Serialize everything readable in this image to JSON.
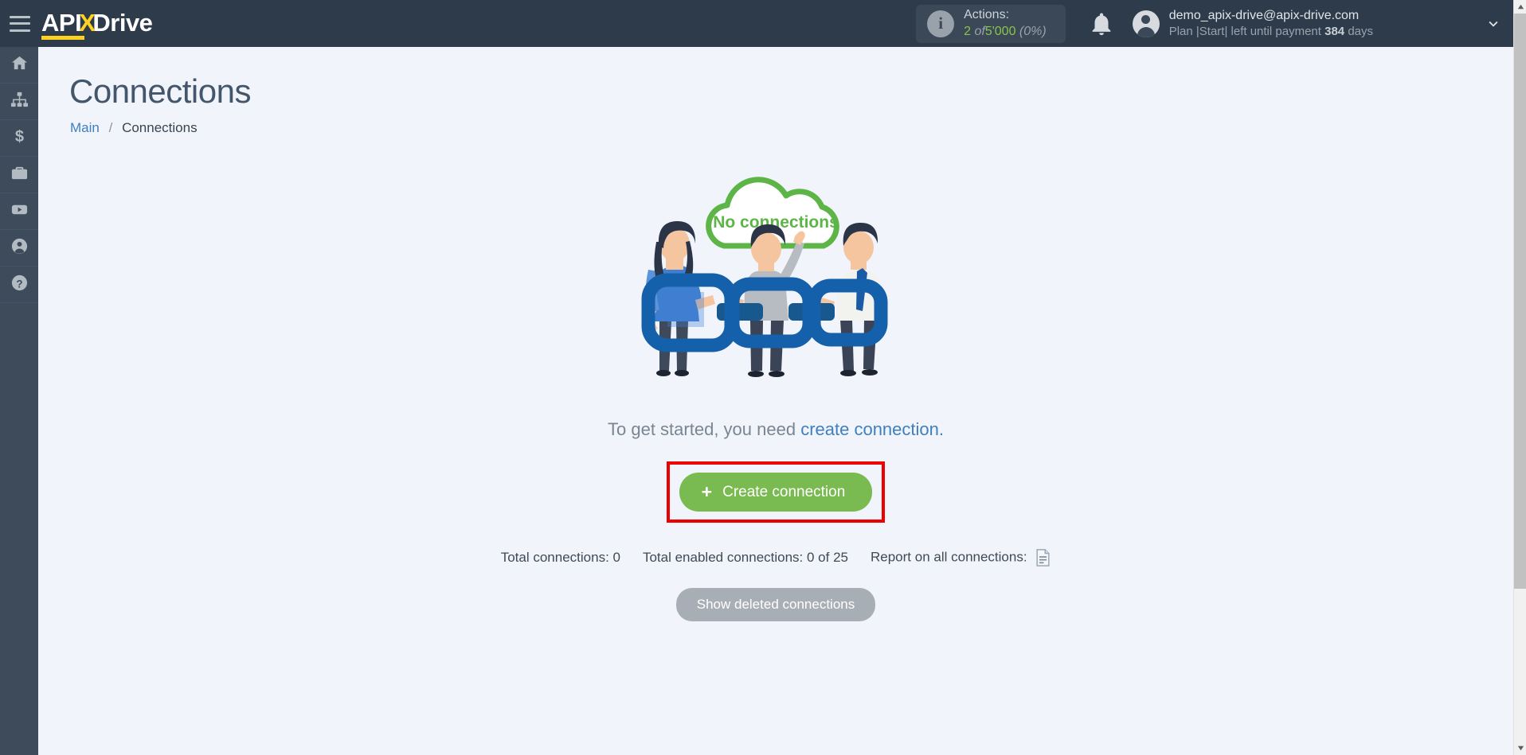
{
  "header": {
    "menu_icon": "hamburger-menu-icon",
    "logo": {
      "part1": "API",
      "part2": "X",
      "part3": "Drive"
    },
    "actions": {
      "label": "Actions:",
      "used": "2",
      "of": "of",
      "total": "5'000",
      "percent": "(0%)",
      "icon": "info-icon"
    },
    "notifications_icon": "bell-icon",
    "user": {
      "avatar": "user-avatar-icon",
      "email": "demo_apix-drive@apix-drive.com",
      "plan_prefix": "Plan |Start| left until payment",
      "plan_days": "384",
      "plan_suffix": "days",
      "chevron": "chevron-down-icon"
    }
  },
  "sidebar": {
    "items": [
      {
        "icon": "home-icon",
        "name": "sidebar-item-home"
      },
      {
        "icon": "sitemap-icon",
        "name": "sidebar-item-connections"
      },
      {
        "icon": "dollar-icon",
        "name": "sidebar-item-billing"
      },
      {
        "icon": "briefcase-icon",
        "name": "sidebar-item-business"
      },
      {
        "icon": "youtube-icon",
        "name": "sidebar-item-video"
      },
      {
        "icon": "user-circle-icon",
        "name": "sidebar-item-account"
      },
      {
        "icon": "question-icon",
        "name": "sidebar-item-help"
      }
    ]
  },
  "main": {
    "title": "Connections",
    "breadcrumb": {
      "root": "Main",
      "separator": "/",
      "current": "Connections"
    },
    "empty_state": {
      "cloud_label": "No connections",
      "illustration": "three-people-holding-chain-illustration"
    },
    "hint": {
      "text": "To get started, you need",
      "link": "create connection."
    },
    "create_button": {
      "plus": "+",
      "label": "Create connection"
    },
    "stats": {
      "total_connections": "Total connections: 0",
      "total_enabled": "Total enabled connections: 0 of 25",
      "report_label": "Report on all connections:",
      "report_icon": "document-report-icon"
    },
    "show_deleted_button": "Show deleted connections"
  },
  "colors": {
    "header_bg": "#2e3b4a",
    "sidebar_bg": "#3d4b5b",
    "accent_yellow": "#ffd21f",
    "link_blue": "#3f7fbf",
    "green_button": "#79bb50",
    "green_cloud": "#5db447",
    "highlight_red": "#ed0000",
    "page_bg": "#f1f5fb",
    "chain_blue": "#10559a"
  }
}
